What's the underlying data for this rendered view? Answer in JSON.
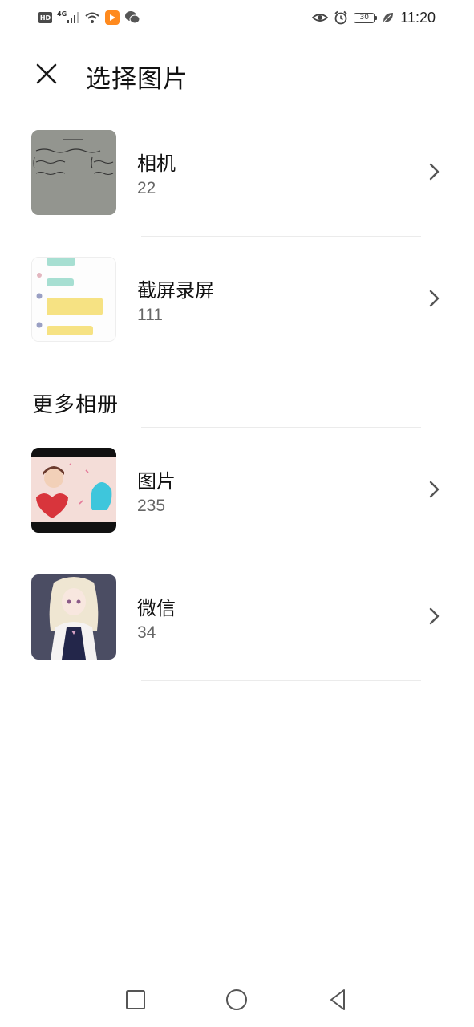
{
  "status_bar": {
    "hd_label": "HD",
    "network_type": "4G",
    "battery_level": "30",
    "time": "11:20",
    "icons": [
      "hd-icon",
      "signal-icon",
      "wifi-icon",
      "video-app-icon",
      "wechat-icon",
      "eye-comfort-icon",
      "alarm-icon",
      "battery-icon",
      "power-saving-leaf-icon"
    ]
  },
  "header": {
    "title": "选择图片",
    "close_icon": "close-icon"
  },
  "albums": [
    {
      "name": "相机",
      "count": "22"
    },
    {
      "name": "截屏录屏",
      "count": "111"
    }
  ],
  "more_section": {
    "title": "更多相册",
    "albums": [
      {
        "name": "图片",
        "count": "235"
      },
      {
        "name": "微信",
        "count": "34"
      }
    ]
  },
  "nav_bar": {
    "icons": [
      "recents-square-icon",
      "home-circle-icon",
      "back-triangle-icon"
    ]
  },
  "colors": {
    "background": "#ffffff",
    "title_text": "#111111",
    "count_text": "#666666",
    "divider": "#ebebeb",
    "chevron": "#555555"
  }
}
